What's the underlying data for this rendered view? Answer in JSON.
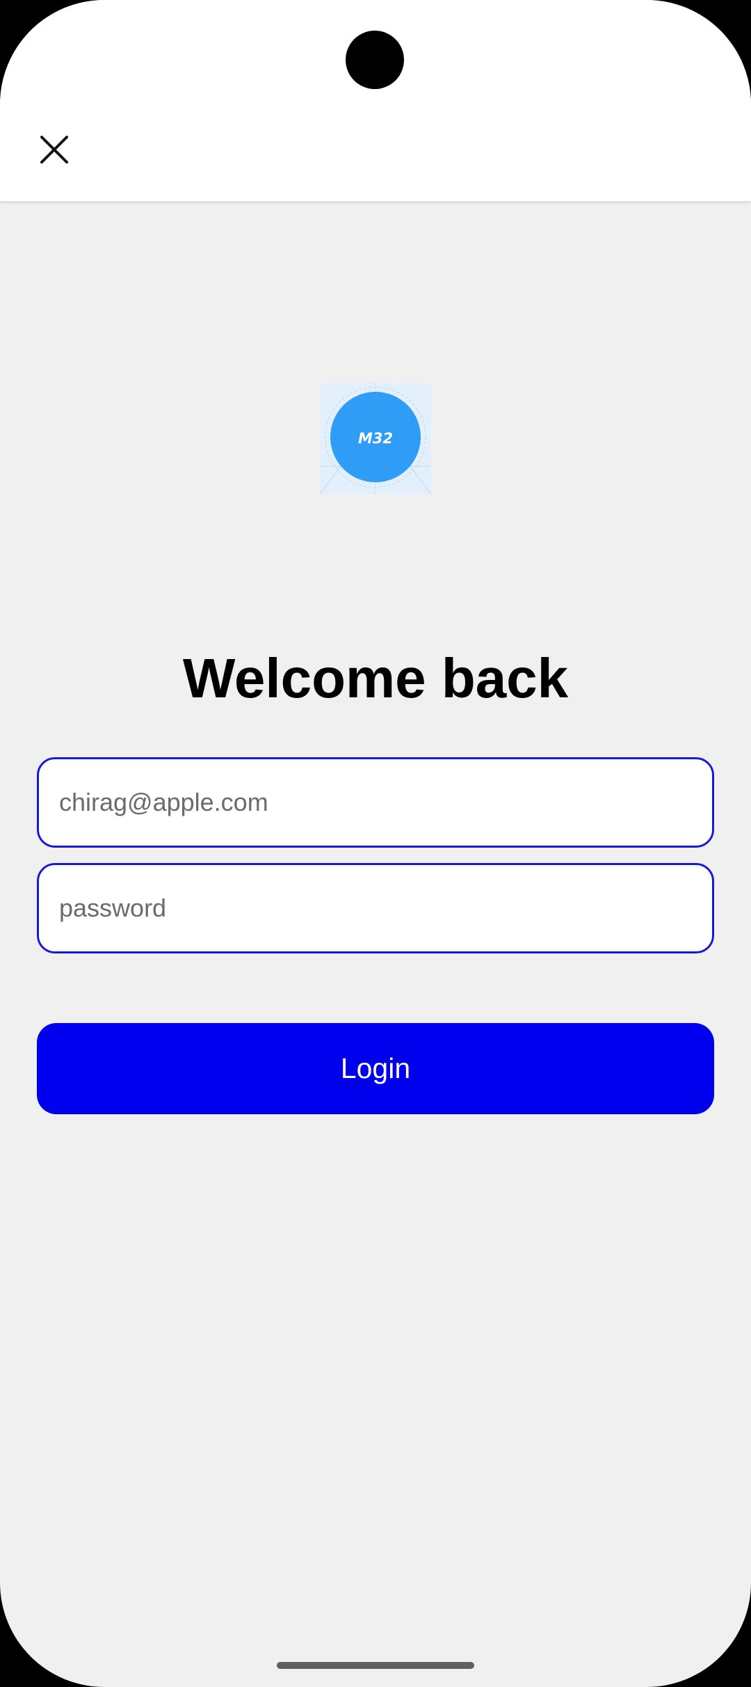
{
  "app_bar": {
    "close_icon": "close-icon"
  },
  "logo": {
    "text": "M32",
    "circle_color": "#2f9cf5",
    "background_color": "#e3f0fc"
  },
  "title": "Welcome back",
  "form": {
    "email": {
      "placeholder": "chirag@apple.com",
      "value": ""
    },
    "password": {
      "placeholder": "password",
      "value": ""
    },
    "login_label": "Login"
  },
  "colors": {
    "accent": "#0000ee",
    "field_border": "#1a1ad6",
    "background": "#f0f0f0",
    "app_bar": "#ffffff"
  }
}
